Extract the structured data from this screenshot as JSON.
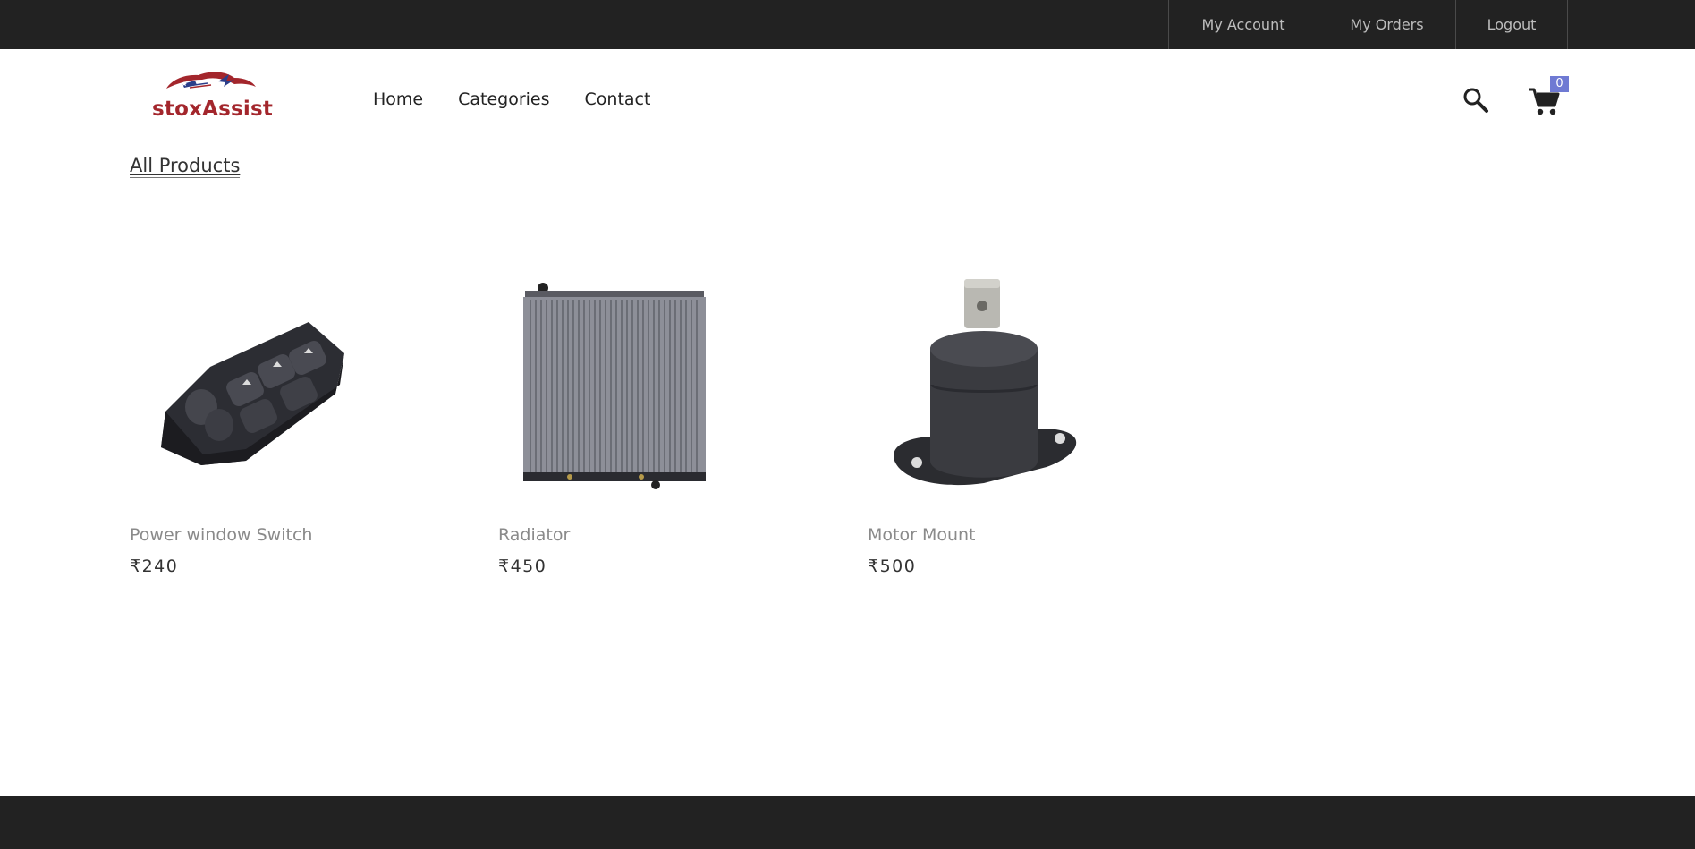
{
  "topbar": {
    "links": [
      "My Account",
      "My Orders",
      "Logout"
    ]
  },
  "brand": {
    "name": "stoxAssist",
    "color": "#a3262c",
    "accent_blue": "#2b3e8a"
  },
  "nav": {
    "items": [
      "Home",
      "Categories",
      "Contact"
    ]
  },
  "header_icons": {
    "search": "search-icon",
    "cart": "cart-icon",
    "cart_count": "0"
  },
  "section": {
    "title": "All Products"
  },
  "products": [
    {
      "name": "Power window Switch",
      "price": "₹240",
      "image": "power-window-switch-image"
    },
    {
      "name": "Radiator",
      "price": "₹450",
      "image": "radiator-image"
    },
    {
      "name": "Motor Mount",
      "price": "₹500",
      "image": "motor-mount-image"
    }
  ],
  "colors": {
    "dark_bar": "#222222",
    "badge": "#6f7ad3",
    "product_name": "#8a8a8a"
  }
}
